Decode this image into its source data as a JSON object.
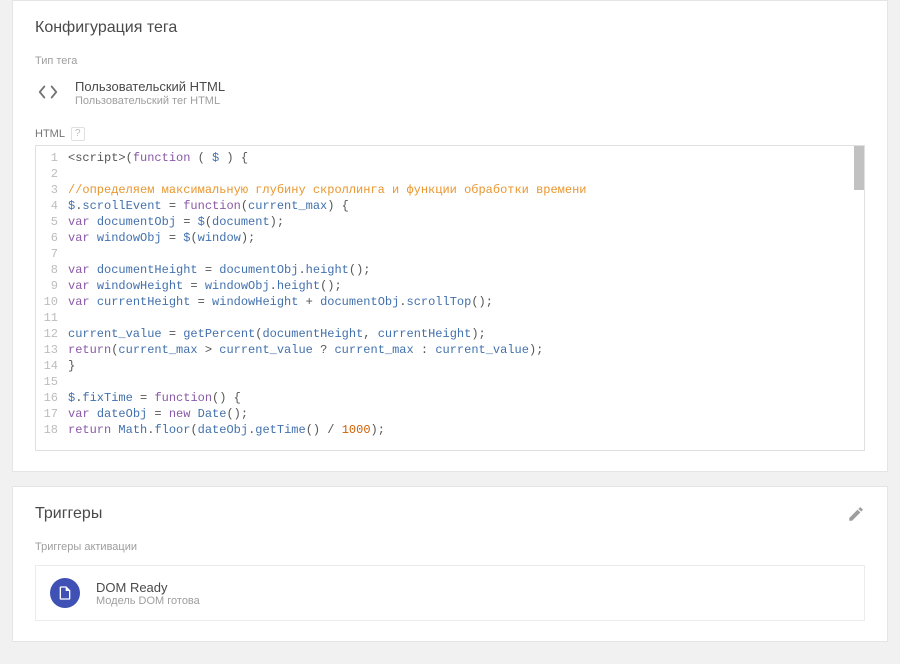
{
  "tag_config": {
    "title": "Конфигурация тега",
    "type_label": "Тип тега",
    "type_name": "Пользовательский HTML",
    "type_desc": "Пользовательский тег HTML",
    "html_label": "HTML",
    "help": "?",
    "code_lines": [
      "<script>(function ( $ ) {",
      "",
      "//определяем максимальную глубину скроллинга и функции обработки времени",
      "$.scrollEvent = function(current_max) {",
      "var documentObj = $(document);",
      "var windowObj = $(window);",
      "",
      "var documentHeight = documentObj.height();",
      "var windowHeight = windowObj.height();",
      "var currentHeight = windowHeight + documentObj.scrollTop();",
      "",
      "current_value = getPercent(documentHeight, currentHeight);",
      "return(current_max > current_value ? current_max : current_value);",
      "}",
      "",
      "$.fixTime = function() {",
      "var dateObj = new Date();",
      "return Math.floor(dateObj.getTime() / 1000);"
    ]
  },
  "triggers": {
    "title": "Триггеры",
    "activation_label": "Триггеры активации",
    "item": {
      "name": "DOM Ready",
      "desc": "Модель DOM готова"
    }
  }
}
